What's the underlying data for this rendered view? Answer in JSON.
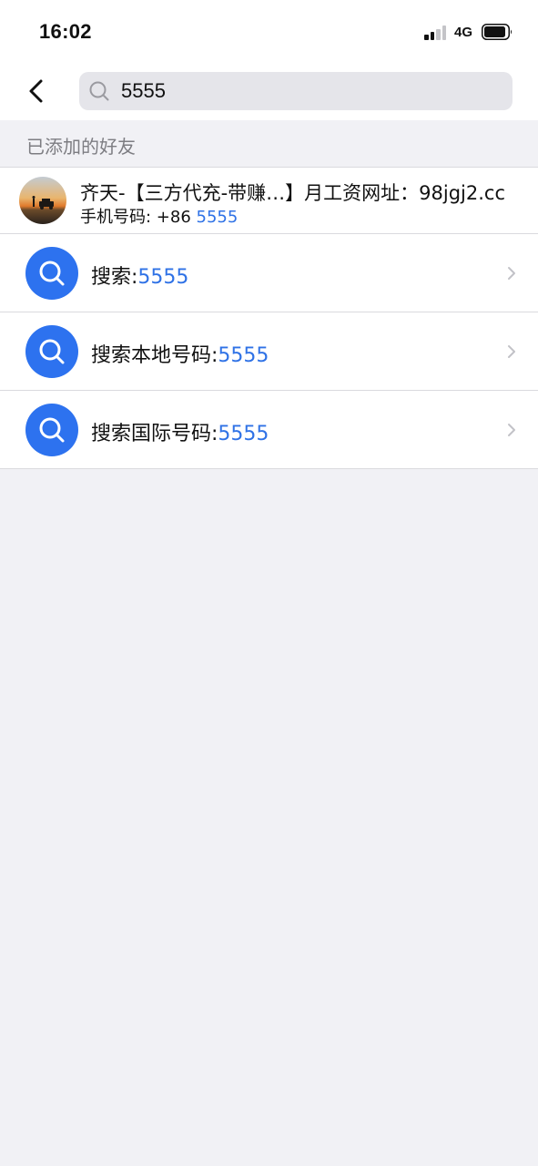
{
  "status_bar": {
    "time": "16:02",
    "network": "4G"
  },
  "search": {
    "query": "5555"
  },
  "section": {
    "title": "已添加的好友"
  },
  "friend": {
    "name": "齐天-【三方代充-带赚…】月工资网址：98jgj2.cc",
    "phone_prefix": "手机号码: +86 ",
    "phone_match": "5555"
  },
  "search_actions": [
    {
      "label": "搜索:",
      "query": "5555"
    },
    {
      "label": "搜索本地号码:",
      "query": "5555"
    },
    {
      "label": "搜索国际号码:",
      "query": "5555"
    }
  ],
  "colors": {
    "accent": "#2d72ef",
    "highlight": "#2f72e6",
    "background": "#f1f1f5"
  }
}
